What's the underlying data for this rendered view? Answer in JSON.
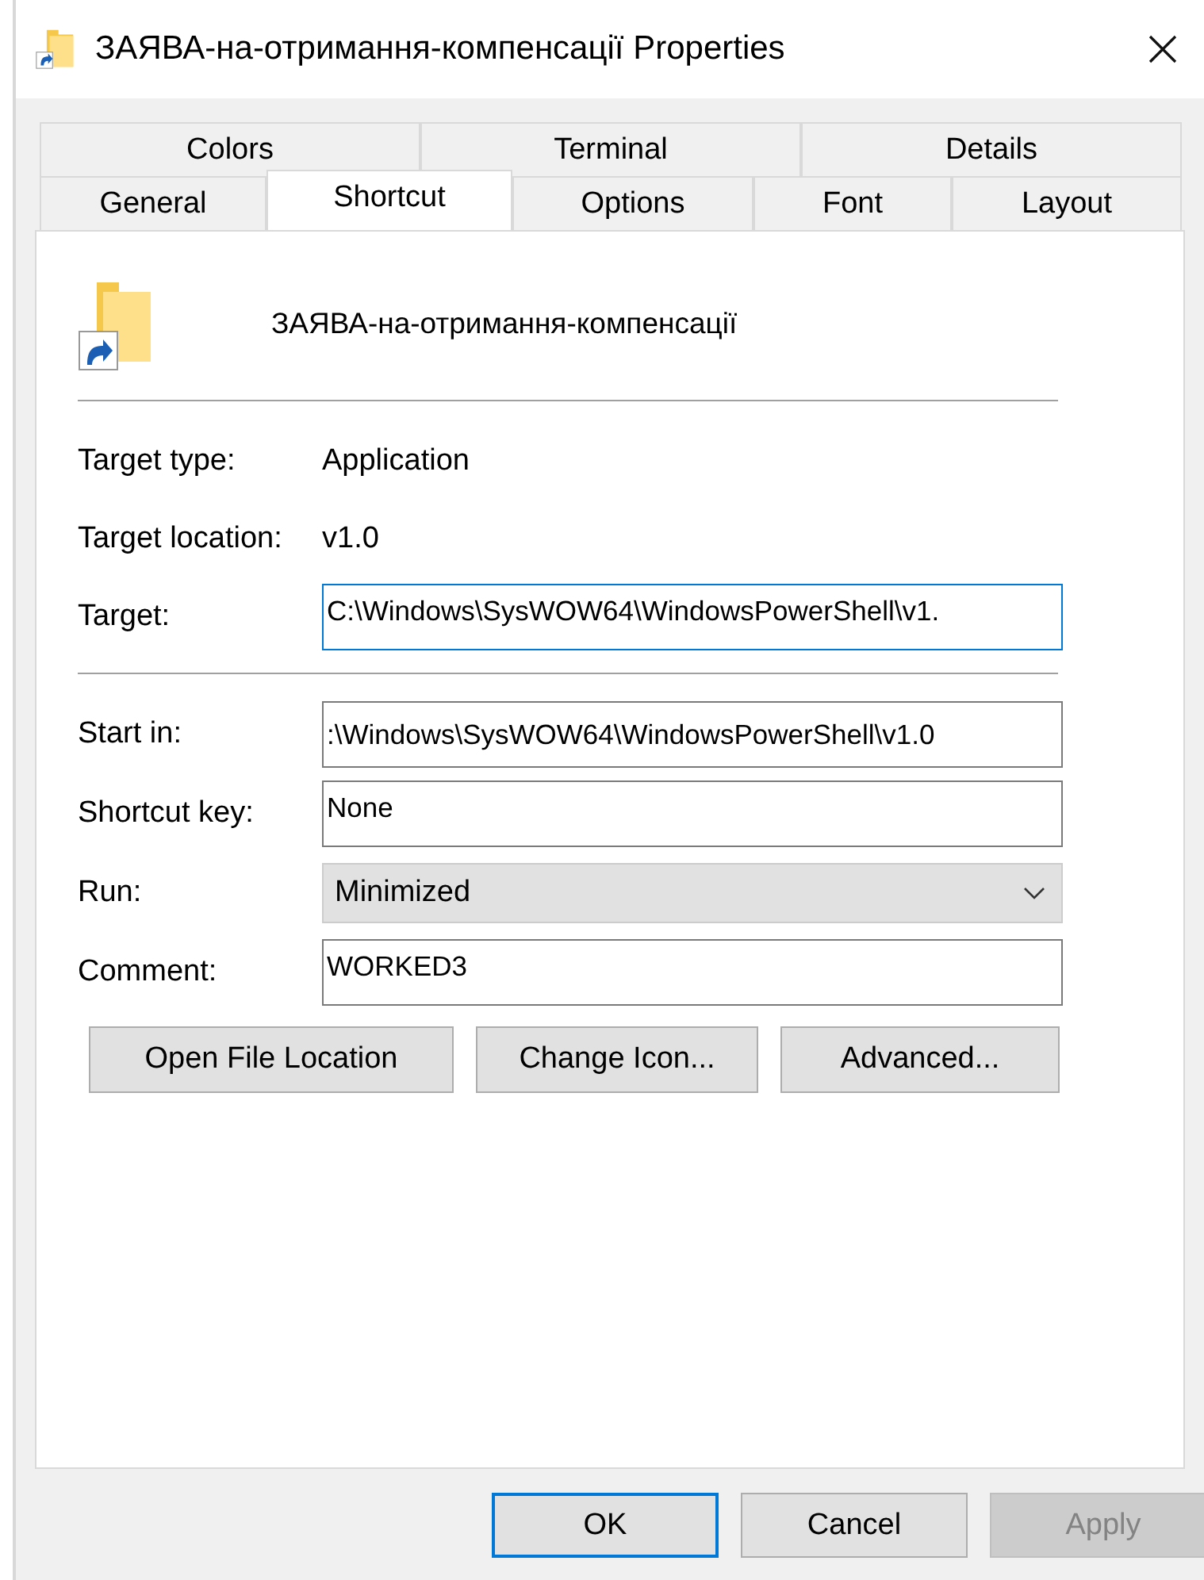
{
  "window": {
    "title": "ЗАЯВА-на-отримання-компенсації Properties"
  },
  "tab_rows": [
    [
      {
        "label": "Colors",
        "selected": false
      },
      {
        "label": "Terminal",
        "selected": false
      },
      {
        "label": "Details",
        "selected": false
      }
    ],
    [
      {
        "label": "General",
        "selected": false
      },
      {
        "label": "Shortcut",
        "selected": true
      },
      {
        "label": "Options",
        "selected": false
      },
      {
        "label": "Font",
        "selected": false
      },
      {
        "label": "Layout",
        "selected": false
      }
    ]
  ],
  "shortcut_name": "ЗАЯВА-на-отримання-компенсації",
  "sections": [
    [
      {
        "kind": "text",
        "label": "Target type:",
        "value": "Application"
      },
      {
        "kind": "text",
        "label": "Target location:",
        "value": "v1.0"
      },
      {
        "kind": "field",
        "label": "Target:",
        "value": "C:\\Windows\\SysWOW64\\WindowsPowerShell\\v1.",
        "focused": true
      }
    ],
    [
      {
        "kind": "field",
        "label": "Start in:",
        "value": ":\\Windows\\SysWOW64\\WindowsPowerShell\\v1.0",
        "focused": false
      },
      {
        "kind": "field",
        "label": "Shortcut key:",
        "value": "None",
        "focused": false
      },
      {
        "kind": "dropdown",
        "label": "Run:",
        "value": "Minimized"
      },
      {
        "kind": "field",
        "label": "Comment:",
        "value": "WORKED3",
        "focused": false
      }
    ]
  ],
  "actions": [
    "Open File Location",
    "Change Icon...",
    "Advanced..."
  ],
  "buttons": [
    {
      "label": "OK",
      "default": true,
      "disabled": false
    },
    {
      "label": "Cancel",
      "default": false,
      "disabled": false
    },
    {
      "label": "Apply",
      "default": false,
      "disabled": true
    }
  ]
}
